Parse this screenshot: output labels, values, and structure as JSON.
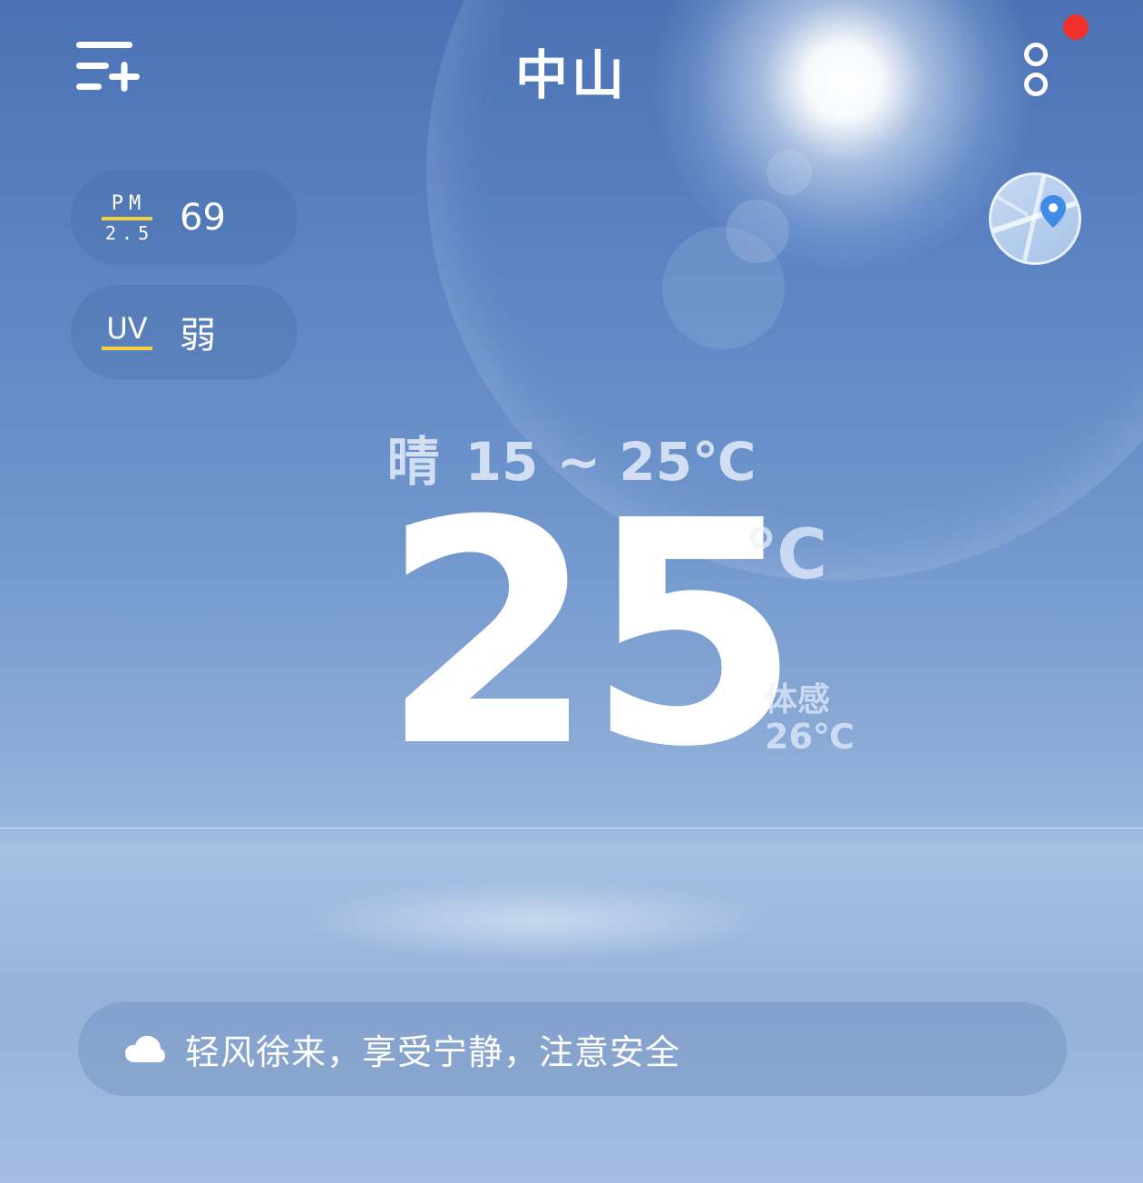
{
  "header": {
    "city": "中山",
    "menu_icon": "add-city-list-icon",
    "more_icon": "more-vertical-icon",
    "notification_color": "#f0312c"
  },
  "air": {
    "pm_top": "PM",
    "pm_bottom": "2.5",
    "pm_value": "69",
    "uv_label": "UV",
    "uv_value": "弱",
    "accent_color": "#f0d23c"
  },
  "map": {
    "icon": "location-pin-icon"
  },
  "today": {
    "condition": "晴",
    "range": "15 ~ 25℃",
    "temperature": "25",
    "unit": "℃",
    "feels_label": "体感",
    "feels_value": "26℃"
  },
  "tip": {
    "icon": "cloud-icon",
    "text": "轻风徐来，享受宁静，注意安全"
  }
}
